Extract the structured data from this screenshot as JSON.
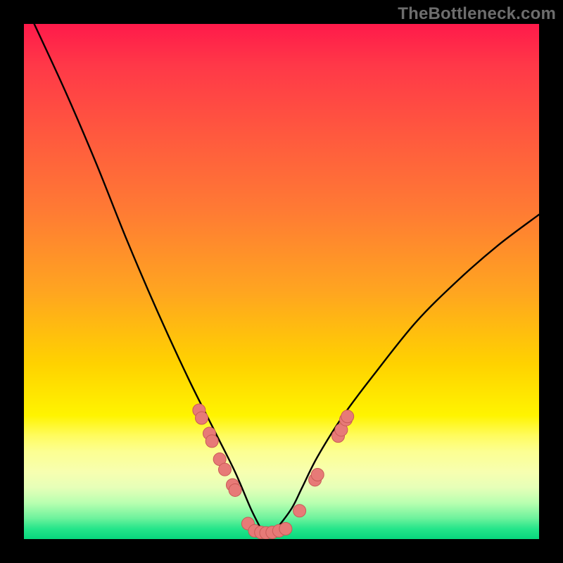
{
  "watermark": "TheBottleneck.com",
  "chart_data": {
    "type": "line",
    "title": "",
    "xlabel": "",
    "ylabel": "",
    "ylim": [
      0,
      100
    ],
    "xlim": [
      0,
      100
    ],
    "note": "V-shaped bottleneck curve over red→yellow→green vertical gradient; minimum near x≈47; salmon dot markers clustered on the flanks of the valley and along its floor.",
    "series": [
      {
        "name": "bottleneck-curve",
        "x": [
          2,
          8,
          14,
          20,
          26,
          32,
          37,
          41,
          44,
          46,
          47,
          49,
          52,
          54,
          57,
          62,
          68,
          76,
          84,
          92,
          100
        ],
        "y": [
          100,
          87,
          73,
          58,
          44,
          31,
          21,
          13,
          6,
          2,
          0,
          2,
          6,
          10,
          16,
          24,
          32,
          42,
          50,
          57,
          63
        ]
      }
    ],
    "markers": [
      {
        "x": 34.0,
        "y": 25.0
      },
      {
        "x": 34.5,
        "y": 23.5
      },
      {
        "x": 36.0,
        "y": 20.5
      },
      {
        "x": 36.5,
        "y": 19.0
      },
      {
        "x": 38.0,
        "y": 15.5
      },
      {
        "x": 39.0,
        "y": 13.5
      },
      {
        "x": 40.5,
        "y": 10.5
      },
      {
        "x": 41.0,
        "y": 9.5
      },
      {
        "x": 43.5,
        "y": 3.0
      },
      {
        "x": 44.8,
        "y": 1.6
      },
      {
        "x": 46.0,
        "y": 1.3
      },
      {
        "x": 47.0,
        "y": 1.2
      },
      {
        "x": 48.2,
        "y": 1.3
      },
      {
        "x": 49.5,
        "y": 1.6
      },
      {
        "x": 50.8,
        "y": 2.0
      },
      {
        "x": 53.5,
        "y": 5.5
      },
      {
        "x": 56.5,
        "y": 11.5
      },
      {
        "x": 57.0,
        "y": 12.5
      },
      {
        "x": 61.0,
        "y": 20.0
      },
      {
        "x": 61.6,
        "y": 21.2
      },
      {
        "x": 62.5,
        "y": 23.2
      },
      {
        "x": 62.8,
        "y": 23.8
      }
    ],
    "colors": {
      "curve": "#000000",
      "marker_fill": "#e77a77",
      "marker_stroke": "#c95a57",
      "gradient_top": "#ff1a4a",
      "gradient_mid": "#fff400",
      "gradient_bottom": "#08d77d"
    }
  }
}
